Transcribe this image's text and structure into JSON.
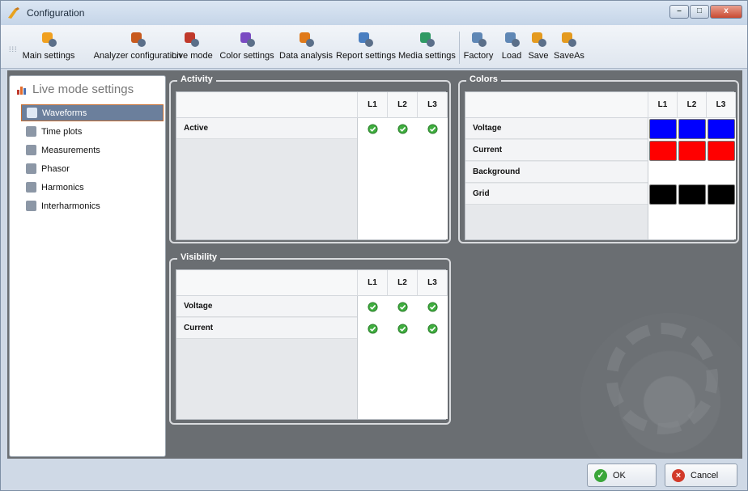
{
  "window": {
    "title": "Configuration",
    "min": "–",
    "max": "□",
    "close": "x"
  },
  "toolbar": {
    "items": [
      {
        "label": "Main settings",
        "icon": "gear-icon",
        "color": "#f0a020"
      },
      {
        "label": "Analyzer configuration",
        "icon": "analyzer-icon",
        "color": "#c85a1e"
      },
      {
        "label": "Live mode",
        "icon": "live-mode-icon",
        "color": "#c0392b"
      },
      {
        "label": "Color settings",
        "icon": "color-wheel-icon",
        "color": "#7a4bc2"
      },
      {
        "label": "Data analysis",
        "icon": "data-analysis-icon",
        "color": "#e07a1a"
      },
      {
        "label": "Report settings",
        "icon": "report-icon",
        "color": "#4a7fc1"
      },
      {
        "label": "Media settings",
        "icon": "media-icon",
        "color": "#2f9a64"
      },
      {
        "label": "Factory",
        "icon": "factory-icon",
        "color": "#5f87b5"
      },
      {
        "label": "Load",
        "icon": "load-icon",
        "color": "#5f87b5"
      },
      {
        "label": "Save",
        "icon": "save-icon",
        "color": "#e49a1f"
      },
      {
        "label": "SaveAs",
        "icon": "save-as-icon",
        "color": "#e49a1f"
      }
    ]
  },
  "sidebar": {
    "title": "Live mode settings",
    "items": [
      {
        "label": "Waveforms",
        "selected": true
      },
      {
        "label": "Time plots",
        "selected": false
      },
      {
        "label": "Measurements",
        "selected": false
      },
      {
        "label": "Phasor",
        "selected": false
      },
      {
        "label": "Harmonics",
        "selected": false
      },
      {
        "label": "Interharmonics",
        "selected": false
      }
    ]
  },
  "activity": {
    "title": "Activity",
    "columns": [
      "L1",
      "L2",
      "L3"
    ],
    "rows": [
      {
        "label": "Active",
        "values": [
          true,
          true,
          true
        ]
      }
    ]
  },
  "visibility": {
    "title": "Visibility",
    "columns": [
      "L1",
      "L2",
      "L3"
    ],
    "rows": [
      {
        "label": "Voltage",
        "values": [
          true,
          true,
          true
        ]
      },
      {
        "label": "Current",
        "values": [
          true,
          true,
          true
        ]
      }
    ]
  },
  "colors": {
    "title": "Colors",
    "columns": [
      "L1",
      "L2",
      "L3"
    ],
    "rows": [
      {
        "label": "Voltage",
        "values": [
          "#0000ff",
          "#0000ff",
          "#0000ff"
        ]
      },
      {
        "label": "Current",
        "values": [
          "#ff0000",
          "#ff0000",
          "#ff0000"
        ]
      },
      {
        "label": "Background",
        "values": [
          "#ffffff",
          "#ffffff",
          "#ffffff"
        ]
      },
      {
        "label": "Grid",
        "values": [
          "#000000",
          "#000000",
          "#000000"
        ]
      }
    ]
  },
  "footer": {
    "ok": "OK",
    "cancel": "Cancel"
  }
}
